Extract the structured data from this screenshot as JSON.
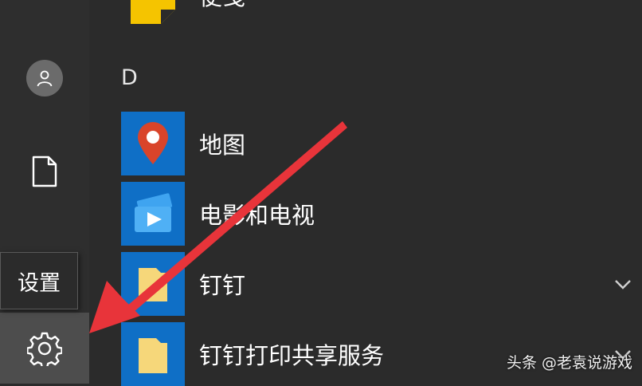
{
  "sidebar": {
    "tooltip": "设置",
    "icons": [
      "user-icon",
      "document-icon",
      "gear-icon"
    ]
  },
  "app_list": {
    "top_partial_label": "便笺",
    "section_letter": "D",
    "items": [
      {
        "label": "地图",
        "icon": "maps-icon",
        "expandable": false
      },
      {
        "label": "电影和电视",
        "icon": "movies-tv-icon",
        "expandable": false
      },
      {
        "label": "钉钉",
        "icon": "folder-icon",
        "expandable": true
      },
      {
        "label": "钉钉打印共享服务",
        "icon": "folder-icon",
        "expandable": true
      }
    ]
  },
  "watermark": "头条 @老袁说游戏",
  "annotation": {
    "color": "#e8343a",
    "points_to": "settings-button"
  },
  "colors": {
    "tile": "#0f6fc6",
    "background": "#2b2b2b",
    "rail": "#2e2e2e",
    "settings_hover": "#4d4d4d",
    "folder": "#f6d77a",
    "sticky": "#f5c400"
  }
}
